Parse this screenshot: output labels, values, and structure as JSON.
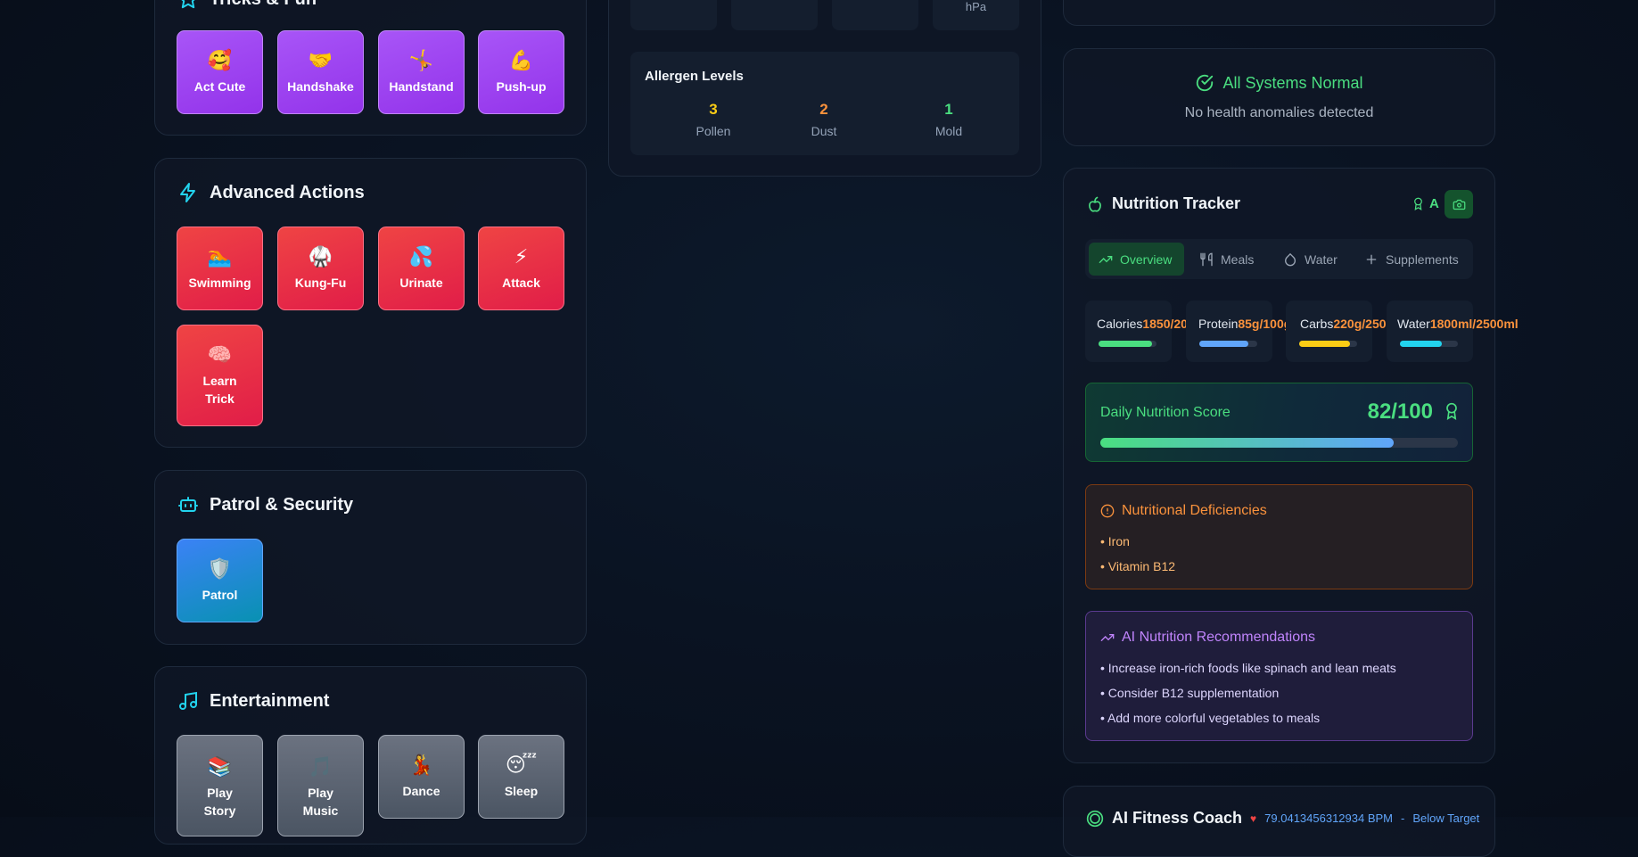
{
  "tricks": {
    "title": "Tricks & Fun",
    "items": [
      {
        "emoji": "🥰",
        "label": "Act Cute"
      },
      {
        "emoji": "🤝",
        "label": "Handshake"
      },
      {
        "emoji": "🤸",
        "label": "Handstand"
      },
      {
        "emoji": "💪",
        "label": "Push-up"
      }
    ]
  },
  "advanced": {
    "title": "Advanced Actions",
    "items": [
      {
        "emoji": "🏊",
        "label": "Swimming"
      },
      {
        "emoji": "🥋",
        "label": "Kung-Fu"
      },
      {
        "emoji": "💦",
        "label": "Urinate"
      },
      {
        "emoji": "⚡",
        "label": "Attack"
      },
      {
        "emoji": "🧠",
        "label": "Learn Trick"
      }
    ]
  },
  "patrol": {
    "title": "Patrol & Security",
    "items": [
      {
        "emoji": "🛡️",
        "label": "Patrol"
      }
    ]
  },
  "entertainment": {
    "title": "Entertainment",
    "items": [
      {
        "emoji": "📚",
        "label": "Play Story"
      },
      {
        "emoji": "🎵",
        "label": "Play Music"
      },
      {
        "emoji": "💃",
        "label": "Dance"
      },
      {
        "emoji": "😴",
        "label": "Sleep"
      }
    ]
  },
  "environment": {
    "pressure_unit": "hPa",
    "allergen": {
      "title": "Allergen Levels",
      "items": [
        {
          "value": "3",
          "label": "Pollen",
          "color": "#facc15"
        },
        {
          "value": "2",
          "label": "Dust",
          "color": "#fb923c"
        },
        {
          "value": "1",
          "label": "Mold",
          "color": "#4ade80"
        }
      ]
    }
  },
  "health": {
    "status": "All Systems Normal",
    "message": "No health anomalies detected"
  },
  "nutrition": {
    "title": "Nutrition Tracker",
    "grade": "A",
    "tabs": [
      {
        "label": "Overview",
        "icon": "trending-up-icon"
      },
      {
        "label": "Meals",
        "icon": "utensils-icon"
      },
      {
        "label": "Water",
        "icon": "droplet-icon"
      },
      {
        "label": "Supplements",
        "icon": "plus-icon"
      }
    ],
    "stats": [
      {
        "label": "Calories",
        "value": "1850/2000",
        "fraction": 0.925,
        "color": "#4ade80"
      },
      {
        "label": "Protein",
        "value": "85g/100g",
        "fraction": 0.85,
        "color": "#60a5fa"
      },
      {
        "label": "Carbs",
        "value": "220g/250g",
        "fraction": 0.88,
        "color": "#facc15"
      },
      {
        "label": "Water",
        "value": "1800ml/2500ml",
        "fraction": 0.72,
        "color": "#22d3ee"
      }
    ],
    "score": {
      "label": "Daily Nutrition Score",
      "value": "82/100",
      "fraction": 0.82
    },
    "deficiencies": {
      "title": "Nutritional Deficiencies",
      "items": [
        "• Iron",
        "• Vitamin B12"
      ]
    },
    "recommendations": {
      "title": "AI Nutrition Recommendations",
      "items": [
        "• Increase iron-rich foods like spinach and lean meats",
        "• Consider B12 supplementation",
        "• Add more colorful vegetables to meals"
      ]
    }
  },
  "fitness": {
    "title": "AI Fitness Coach",
    "heart_rate": "79.0413456312934 BPM",
    "target": "Below Target"
  }
}
